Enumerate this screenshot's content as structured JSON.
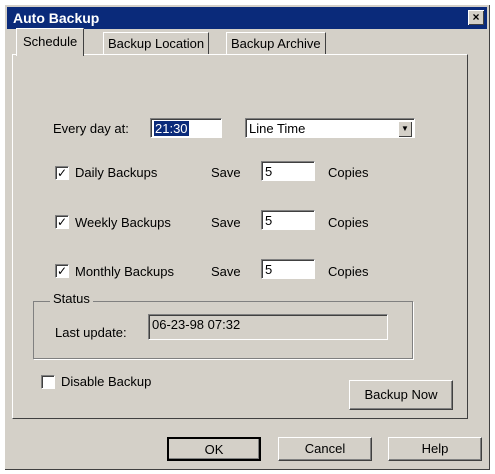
{
  "window": {
    "title": "Auto Backup",
    "close_glyph": "×"
  },
  "tabs": [
    {
      "label": "Schedule",
      "active": true
    },
    {
      "label": "Backup Location",
      "active": false
    },
    {
      "label": "Backup Archive",
      "active": false
    }
  ],
  "schedule": {
    "every_day_label": "Every day at:",
    "time_value": "21:30",
    "time_mode": "Line Time",
    "rows": [
      {
        "label": "Daily Backups",
        "checked": true,
        "save_label": "Save",
        "copies": "5",
        "copies_label": "Copies"
      },
      {
        "label": "Weekly Backups",
        "checked": true,
        "save_label": "Save",
        "copies": "5",
        "copies_label": "Copies"
      },
      {
        "label": "Monthly Backups",
        "checked": true,
        "save_label": "Save",
        "copies": "5",
        "copies_label": "Copies"
      }
    ],
    "status": {
      "title": "Status",
      "last_update_label": "Last update:",
      "last_update_value": "06-23-98 07:32"
    },
    "disable_backup_label": "Disable Backup",
    "disable_backup_checked": false,
    "backup_now_label": "Backup Now"
  },
  "footer": {
    "ok_label": "OK",
    "cancel_label": "Cancel",
    "help_label": "Help"
  },
  "icons": {
    "check": "✓",
    "dropdown": "▼"
  }
}
